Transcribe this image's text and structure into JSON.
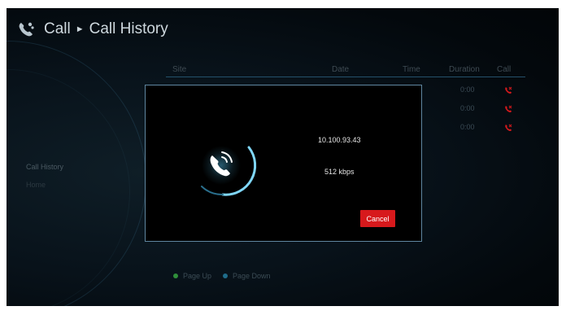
{
  "header": {
    "section": "Call",
    "separator": "►",
    "page": "Call History"
  },
  "table": {
    "columns": [
      "Site",
      "Date",
      "Time",
      "Duration",
      "Call"
    ],
    "rows": [
      {
        "duration": "0:00",
        "call_icon": "missed-call-icon"
      },
      {
        "duration": "0:00",
        "call_icon": "missed-call-icon"
      },
      {
        "duration": "0:00",
        "call_icon": "missed-call-icon"
      }
    ]
  },
  "sidebar": {
    "items": [
      {
        "label": "Call History"
      },
      {
        "label": "Home"
      }
    ]
  },
  "footer": {
    "page_up": {
      "label": "Page Up",
      "color": "#2f8f3a"
    },
    "page_down": {
      "label": "Page Down",
      "color": "#1f6c8a"
    }
  },
  "dialog": {
    "ip": "10.100.93.43",
    "rate": "512 kbps",
    "cancel_label": "Cancel",
    "icon": "calling-phone-icon"
  },
  "colors": {
    "accent": "#d7191c",
    "glow": "#52c3f0",
    "dialog_border": "#5f86a0"
  }
}
